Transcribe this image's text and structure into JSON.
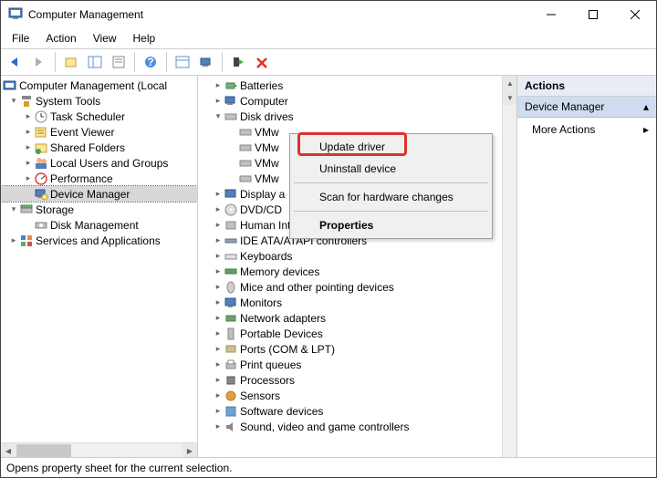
{
  "window": {
    "title": "Computer Management"
  },
  "menu": {
    "file": "File",
    "action": "Action",
    "view": "View",
    "help": "Help"
  },
  "left_tree": {
    "root": "Computer Management (Local",
    "system_tools": "System Tools",
    "task_scheduler": "Task Scheduler",
    "event_viewer": "Event Viewer",
    "shared_folders": "Shared Folders",
    "local_users": "Local Users and Groups",
    "performance": "Performance",
    "device_manager": "Device Manager",
    "storage": "Storage",
    "disk_management": "Disk Management",
    "services_apps": "Services and Applications"
  },
  "center_tree": {
    "batteries": "Batteries",
    "computer": "Computer",
    "disk_drives": "Disk drives",
    "vmw1": "VMw",
    "vmw2": "VMw",
    "vmw3": "VMw",
    "vmw4": "VMw",
    "display_adapters": "Display a",
    "dvd_cd": "DVD/CD",
    "hid": "Human Interface Devices",
    "ide": "IDE ATA/ATAPI controllers",
    "keyboards": "Keyboards",
    "memory": "Memory devices",
    "mice": "Mice and other pointing devices",
    "monitors": "Monitors",
    "network": "Network adapters",
    "portable": "Portable Devices",
    "ports": "Ports (COM & LPT)",
    "print_queues": "Print queues",
    "processors": "Processors",
    "sensors": "Sensors",
    "software": "Software devices",
    "sound": "Sound, video and game controllers"
  },
  "context_menu": {
    "update_driver": "Update driver",
    "uninstall": "Uninstall device",
    "scan": "Scan for hardware changes",
    "properties": "Properties"
  },
  "actions_panel": {
    "header": "Actions",
    "section": "Device Manager",
    "more_actions": "More Actions"
  },
  "status": "Opens property sheet for the current selection."
}
